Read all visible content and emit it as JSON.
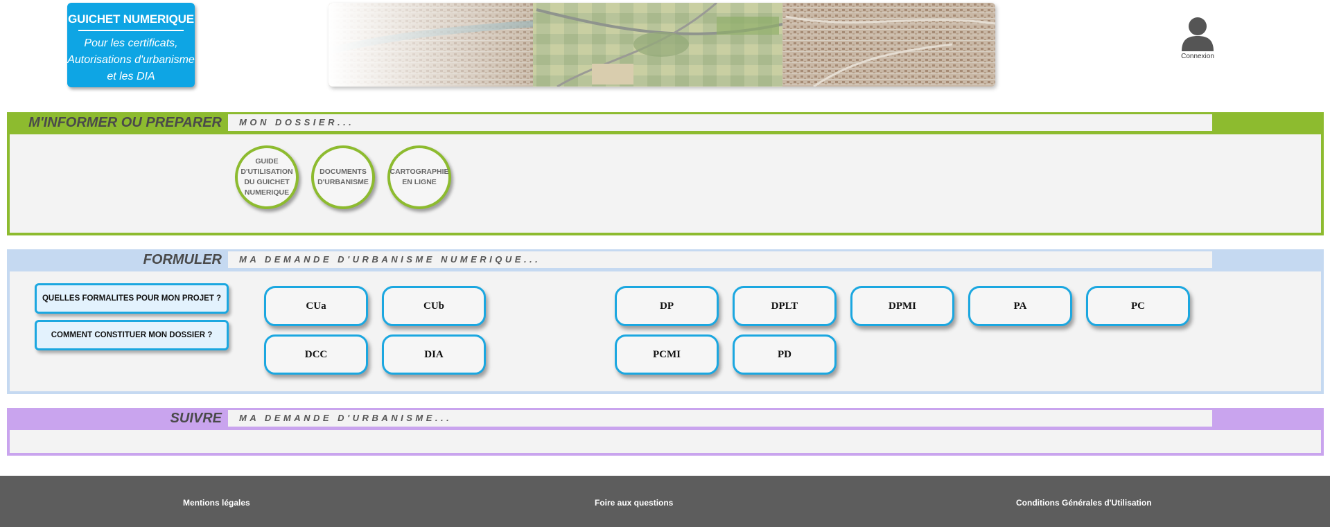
{
  "header": {
    "logo_title": "GUICHET NUMERIQUE",
    "logo_lines": [
      "Pour les certificats,",
      "Autorisations d'urbanisme",
      "et les DIA"
    ],
    "login_label": "Connexion"
  },
  "sections": {
    "inform": {
      "title": "M'INFORMER OU PREPARER",
      "subtitle": "MON DOSSIER...",
      "color": "#8dbb2f",
      "buttons": [
        {
          "label_lines": [
            "GUIDE",
            "D'UTILISATION",
            "DU GUICHET",
            "NUMERIQUE"
          ]
        },
        {
          "label_lines": [
            "DOCUMENTS",
            "D'URBANISME"
          ]
        },
        {
          "label_lines": [
            "CARTOGRAPHIE",
            "EN LIGNE"
          ]
        }
      ]
    },
    "formulate": {
      "title": "FORMULER",
      "subtitle": "MA DEMANDE D'URBANISME NUMERIQUE...",
      "color": "#c5d9f1",
      "questions": [
        "QUELLES FORMALITES POUR MON PROJET ?",
        "COMMENT CONSTITUER MON DOSSIER ?"
      ],
      "forms": [
        "CUa",
        "CUb",
        "DCC",
        "DIA",
        "DP",
        "DPLT",
        "DPMI",
        "PA",
        "PC",
        "PCMI",
        "PD"
      ]
    },
    "follow": {
      "title": "SUIVRE",
      "subtitle": "MA DEMANDE D'URBANISME...",
      "color": "#c9a4ee"
    }
  },
  "footer": {
    "links": [
      "Mentions légales",
      "Foire aux questions",
      "Conditions Générales d'Utilisation"
    ]
  },
  "icons": {
    "user": "user-silhouette-icon"
  },
  "colors": {
    "logo_bg": "#0ea5e4",
    "button_border": "#1ba7e0",
    "footer_bg": "#5d5d5d"
  }
}
